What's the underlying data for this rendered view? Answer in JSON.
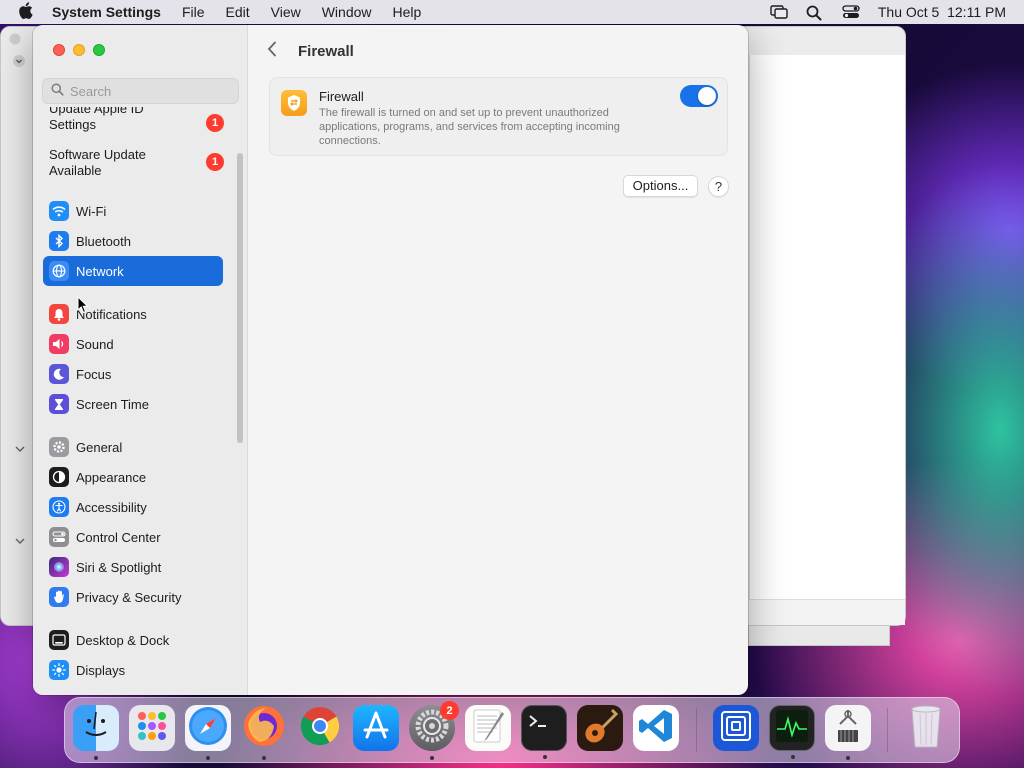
{
  "menubar": {
    "app_name": "System Settings",
    "menus": [
      "File",
      "Edit",
      "View",
      "Window",
      "Help"
    ],
    "clock": "Thu Oct 5  12:11 PM"
  },
  "sidebar": {
    "search_placeholder": "Search",
    "updates": [
      {
        "label": "Update Apple ID Settings",
        "badge": "1"
      },
      {
        "label": "Software Update Available",
        "badge": "1"
      }
    ],
    "items": [
      {
        "label": "Wi-Fi",
        "icon": "wifi-icon",
        "color": "#1f8ff7"
      },
      {
        "label": "Bluetooth",
        "icon": "bluetooth-icon",
        "color": "#1f7cf0"
      },
      {
        "label": "Network",
        "icon": "globe-icon",
        "color": "#3b8cf5"
      },
      {
        "label": "Notifications",
        "icon": "bell-icon",
        "color": "#f4453f"
      },
      {
        "label": "Sound",
        "icon": "speaker-icon",
        "color": "#f23c63"
      },
      {
        "label": "Focus",
        "icon": "moon-icon",
        "color": "#5b57d6"
      },
      {
        "label": "Screen Time",
        "icon": "hourglass-icon",
        "color": "#5e4fd9"
      },
      {
        "label": "General",
        "icon": "gear-icon",
        "color": "#9a9a9f"
      },
      {
        "label": "Appearance",
        "icon": "appearance-icon",
        "color": "#1d1d1f"
      },
      {
        "label": "Accessibility",
        "icon": "accessibility-icon",
        "color": "#1f7cf0"
      },
      {
        "label": "Control Center",
        "icon": "control-center-icon",
        "color": "#8e8e93"
      },
      {
        "label": "Siri & Spotlight",
        "icon": "siri-icon",
        "color": "#7a3fd6"
      },
      {
        "label": "Privacy & Security",
        "icon": "hand-icon",
        "color": "#2f7cf1"
      },
      {
        "label": "Desktop & Dock",
        "icon": "dock-icon",
        "color": "#1d1d1f"
      },
      {
        "label": "Displays",
        "icon": "sun-icon",
        "color": "#1f8ff7"
      }
    ],
    "selected": "Network"
  },
  "content": {
    "title": "Firewall",
    "card": {
      "title": "Firewall",
      "description": "The firewall is turned on and set up to prevent unauthorized applications, programs, and services from accepting incoming connections.",
      "enabled": true
    },
    "options_label": "Options...",
    "help_label": "?"
  },
  "dock": {
    "apps": [
      "Finder",
      "Launchpad",
      "Safari",
      "Firefox",
      "Chrome",
      "App Store",
      "System Settings",
      "TextEdit",
      "Terminal",
      "GarageBand",
      "Visual Studio Code",
      "Screens",
      "Activity Monitor",
      "System Information",
      "Trash"
    ],
    "system_settings_badge": "2"
  }
}
